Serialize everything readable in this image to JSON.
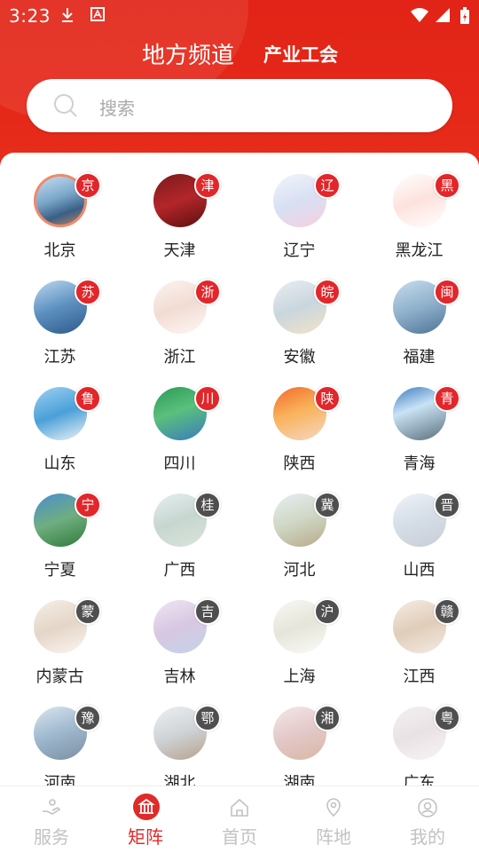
{
  "status_bar": {
    "time": "3:23",
    "left_icons": [
      "download-icon",
      "app-notification-icon"
    ],
    "right_icons": [
      "wifi-icon",
      "signal-icon",
      "battery-charging-icon"
    ]
  },
  "header": {
    "title": "地方频道",
    "subtitle_tab": "产业工会"
  },
  "search": {
    "placeholder": "搜索"
  },
  "provinces": [
    {
      "name": "北京",
      "badge": "京",
      "badge_color": "#e2262a"
    },
    {
      "name": "天津",
      "badge": "津",
      "badge_color": "#e2262a"
    },
    {
      "name": "辽宁",
      "badge": "辽",
      "badge_color": "#e2262a"
    },
    {
      "name": "黑龙江",
      "badge": "黑",
      "badge_color": "#e2262a"
    },
    {
      "name": "江苏",
      "badge": "苏",
      "badge_color": "#e2262a"
    },
    {
      "name": "浙江",
      "badge": "浙",
      "badge_color": "#e2262a"
    },
    {
      "name": "安徽",
      "badge": "皖",
      "badge_color": "#e2262a"
    },
    {
      "name": "福建",
      "badge": "闽",
      "badge_color": "#e2262a"
    },
    {
      "name": "山东",
      "badge": "鲁",
      "badge_color": "#e2262a"
    },
    {
      "name": "四川",
      "badge": "川",
      "badge_color": "#e2262a"
    },
    {
      "name": "陕西",
      "badge": "陕",
      "badge_color": "#e2262a"
    },
    {
      "name": "青海",
      "badge": "青",
      "badge_color": "#e2262a"
    },
    {
      "name": "宁夏",
      "badge": "宁",
      "badge_color": "#e2262a"
    },
    {
      "name": "广西",
      "badge": "桂",
      "badge_color": "#4f4f4f"
    },
    {
      "name": "河北",
      "badge": "冀",
      "badge_color": "#4f4f4f"
    },
    {
      "name": "山西",
      "badge": "晋",
      "badge_color": "#4f4f4f"
    },
    {
      "name": "内蒙古",
      "badge": "蒙",
      "badge_color": "#4f4f4f"
    },
    {
      "name": "吉林",
      "badge": "吉",
      "badge_color": "#4f4f4f"
    },
    {
      "name": "上海",
      "badge": "沪",
      "badge_color": "#4f4f4f"
    },
    {
      "name": "江西",
      "badge": "赣",
      "badge_color": "#4f4f4f"
    },
    {
      "name": "河南",
      "badge": "豫",
      "badge_color": "#4f4f4f"
    },
    {
      "name": "湖北",
      "badge": "鄂",
      "badge_color": "#4f4f4f"
    },
    {
      "name": "湖南",
      "badge": "湘",
      "badge_color": "#4f4f4f"
    },
    {
      "name": "广东",
      "badge": "粤",
      "badge_color": "#4f4f4f"
    }
  ],
  "bottom_nav": [
    {
      "label": "服务",
      "icon": "service-hand-icon",
      "active": false
    },
    {
      "label": "矩阵",
      "icon": "bank-building-icon",
      "active": true
    },
    {
      "label": "首页",
      "icon": "home-icon",
      "active": false
    },
    {
      "label": "阵地",
      "icon": "location-pin-icon",
      "active": false
    },
    {
      "label": "我的",
      "icon": "user-icon",
      "active": false
    }
  ],
  "colors": {
    "brand_red": "#e12417",
    "active_nav": "#e02b2b",
    "inactive_nav": "#c2c2c2"
  }
}
